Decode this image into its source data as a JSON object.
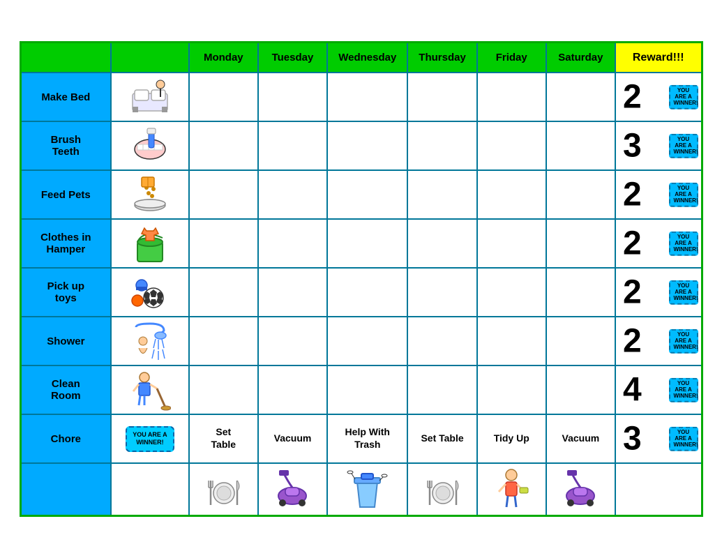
{
  "header": {
    "col1": "",
    "col2": "",
    "days": [
      "Monday",
      "Tuesday",
      "Wednesday",
      "Thursday",
      "Friday",
      "Saturday"
    ],
    "reward": "Reward!!!"
  },
  "rows": [
    {
      "label": "Make Bed",
      "reward_num": "2",
      "icon": "make-bed"
    },
    {
      "label": "Brush\nTeeth",
      "reward_num": "3",
      "icon": "brush-teeth"
    },
    {
      "label": "Feed Pets",
      "reward_num": "2",
      "icon": "feed-pets"
    },
    {
      "label": "Clothes in\nHamper",
      "reward_num": "2",
      "icon": "clothes-hamper"
    },
    {
      "label": "Pick up\ntoys",
      "reward_num": "2",
      "icon": "pick-up-toys"
    },
    {
      "label": "Shower",
      "reward_num": "2",
      "icon": "shower"
    },
    {
      "label": "Clean\nRoom",
      "reward_num": "4",
      "icon": "clean-room"
    }
  ],
  "chore_row": {
    "label": "Chore",
    "reward_num": "3",
    "days": [
      "Set\nTable",
      "Vacuum",
      "Help With\nTrash",
      "Set Table",
      "Tidy Up",
      "Vacuum"
    ]
  },
  "ticket_text": "YOU ARE A WINNER!",
  "bottom_icons": [
    "table-icon",
    "vacuum-icon",
    "trash-icon",
    "table-icon",
    "tidy-icon",
    "vacuum2-icon"
  ]
}
